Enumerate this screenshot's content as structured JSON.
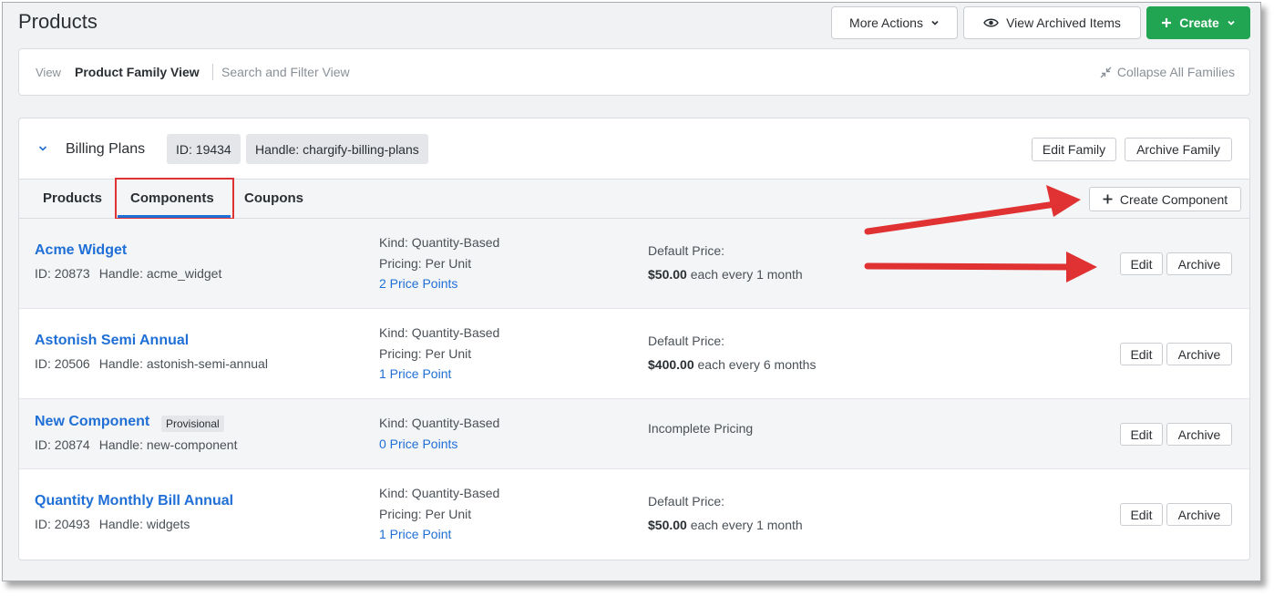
{
  "header": {
    "title": "Products",
    "more_actions": "More Actions",
    "view_archived": "View Archived Items",
    "create": "Create"
  },
  "view_bar": {
    "view_label": "View",
    "family_view": "Product Family View",
    "search_view": "Search and Filter View",
    "collapse_all": "Collapse All Families"
  },
  "family": {
    "name": "Billing Plans",
    "id_chip": "ID: 19434",
    "handle_chip": "Handle: chargify-billing-plans",
    "edit_label": "Edit Family",
    "archive_label": "Archive Family",
    "tabs": [
      "Products",
      "Components",
      "Coupons"
    ],
    "active_tab": "Components",
    "create_component": "Create Component"
  },
  "components": [
    {
      "name": "Acme Widget",
      "id": "ID: 20873",
      "handle": "Handle: acme_widget",
      "kind": "Kind: Quantity-Based",
      "pricing": "Pricing: Per Unit",
      "price_points": "2 Price Points",
      "price_label": "Default Price:",
      "price_amount": "$50.00",
      "price_rest": " each every 1 month"
    },
    {
      "name": "Astonish Semi Annual",
      "id": "ID: 20506",
      "handle": "Handle: astonish-semi-annual",
      "kind": "Kind: Quantity-Based",
      "pricing": "Pricing: Per Unit",
      "price_points": "1 Price Point",
      "price_label": "Default Price:",
      "price_amount": "$400.00",
      "price_rest": " each every 6 months"
    },
    {
      "name": "New Component",
      "badge": "Provisional",
      "id": "ID: 20874",
      "handle": "Handle: new-component",
      "kind": "Kind: Quantity-Based",
      "price_points": "0 Price Points",
      "price_label": "Incomplete Pricing"
    },
    {
      "name": "Quantity Monthly Bill Annual",
      "id": "ID: 20493",
      "handle": "Handle: widgets",
      "kind": "Kind: Quantity-Based",
      "pricing": "Pricing: Per Unit",
      "price_points": "1 Price Point",
      "price_label": "Default Price:",
      "price_amount": "$50.00",
      "price_rest": " each every 1 month"
    }
  ],
  "row_actions": {
    "edit": "Edit",
    "archive": "Archive"
  },
  "colors": {
    "primary_link": "#1f6fd6",
    "create_green": "#22a552",
    "annotation_red": "#e03232"
  }
}
